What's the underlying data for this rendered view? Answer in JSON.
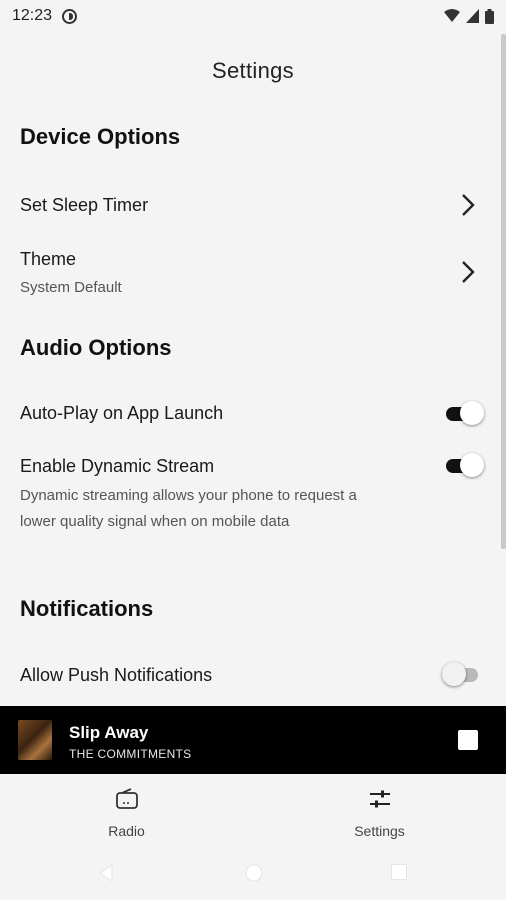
{
  "status_bar": {
    "time": "12:23"
  },
  "header": {
    "title": "Settings"
  },
  "sections": {
    "device": {
      "title": "Device Options",
      "sleep_timer_label": "Set Sleep Timer",
      "theme_label": "Theme",
      "theme_value": "System Default"
    },
    "audio": {
      "title": "Audio Options",
      "autoplay_label": "Auto-Play on App Launch",
      "autoplay_on": true,
      "dynamic_label": "Enable Dynamic Stream",
      "dynamic_on": true,
      "dynamic_desc": "Dynamic streaming allows your phone to request a lower quality signal when on mobile data"
    },
    "notifications": {
      "title": "Notifications",
      "push_label": "Allow Push Notifications",
      "push_on": false
    }
  },
  "now_playing": {
    "title": "Slip Away",
    "artist": "THE COMMITMENTS"
  },
  "tabs": [
    {
      "label": "Radio",
      "icon": "radio-icon"
    },
    {
      "label": "Settings",
      "icon": "sliders-icon"
    }
  ]
}
